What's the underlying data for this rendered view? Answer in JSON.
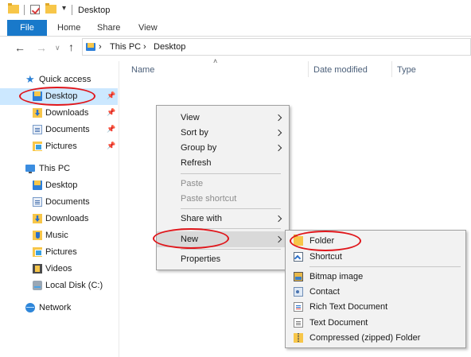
{
  "window": {
    "title": "Desktop",
    "quick_access_dropdown": "▾"
  },
  "ribbon": {
    "tabs": [
      "File",
      "Home",
      "Share",
      "View"
    ]
  },
  "address": {
    "back": "←",
    "forward": "→",
    "recent": "∨",
    "up": "↑",
    "separator": "›",
    "crumbs": [
      "This PC",
      "Desktop"
    ]
  },
  "columns": {
    "sort_indicator": "˄",
    "name": "Name",
    "date_modified": "Date modified",
    "type": "Type"
  },
  "nav": {
    "pin_glyph": "📌",
    "star_glyph": "★",
    "quick_access": "Quick access",
    "quick_items": [
      {
        "label": "Desktop",
        "icon": "desktop-icon",
        "pinned": true,
        "selected": true
      },
      {
        "label": "Downloads",
        "icon": "downloads-icon",
        "pinned": true
      },
      {
        "label": "Documents",
        "icon": "documents-icon",
        "pinned": true
      },
      {
        "label": "Pictures",
        "icon": "pictures-icon",
        "pinned": true
      }
    ],
    "this_pc": "This PC",
    "pc_items": [
      {
        "label": "Desktop",
        "icon": "desktop-icon"
      },
      {
        "label": "Documents",
        "icon": "documents-icon"
      },
      {
        "label": "Downloads",
        "icon": "downloads-icon"
      },
      {
        "label": "Music",
        "icon": "music-icon"
      },
      {
        "label": "Pictures",
        "icon": "pictures-icon"
      },
      {
        "label": "Videos",
        "icon": "videos-icon"
      },
      {
        "label": "Local Disk (C:)",
        "icon": "local-disk-icon"
      }
    ],
    "network": "Network"
  },
  "context_menu": {
    "view": "View",
    "sort_by": "Sort by",
    "group_by": "Group by",
    "refresh": "Refresh",
    "paste": "Paste",
    "paste_shortcut": "Paste shortcut",
    "share_with": "Share with",
    "new": "New",
    "properties": "Properties"
  },
  "new_submenu": {
    "folder": "Folder",
    "shortcut": "Shortcut",
    "bitmap": "Bitmap image",
    "contact": "Contact",
    "rtf": "Rich Text Document",
    "txt": "Text Document",
    "zip": "Compressed (zipped) Folder"
  },
  "colors": {
    "accent": "#1979ca",
    "selection": "#cce8ff",
    "annotation": "#e0161b",
    "folder": "#f7c649"
  }
}
